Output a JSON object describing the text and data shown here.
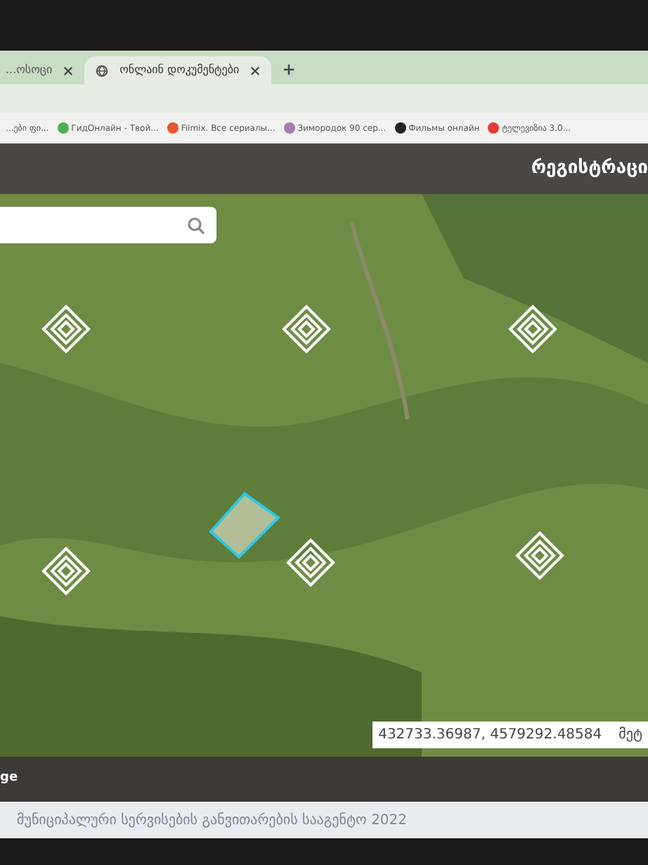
{
  "browser": {
    "tabs": [
      {
        "label": "...ოსოცი",
        "selected": false
      },
      {
        "label": "ონლაინ დოკუმენტები",
        "selected": true
      }
    ],
    "bookmarks": [
      {
        "label": "...ები ფი..."
      },
      {
        "label": "ГидОнлайн - Твой..."
      },
      {
        "label": "Filmix. Все сериалы..."
      },
      {
        "label": "Зимородок 90 сер..."
      },
      {
        "label": "Фильмы онлайн"
      },
      {
        "label": "ტელევიზია 3.0..."
      }
    ]
  },
  "header": {
    "title": "რეგისტრაცი"
  },
  "map": {
    "coordinates": "432733.36987, 4579292.48584",
    "coordinates_suffix": "მეტ"
  },
  "footer": {
    "left_text": "ge",
    "copyright": "მუნიციპალური სერვისების განვითარების სააგენტო 2022"
  }
}
